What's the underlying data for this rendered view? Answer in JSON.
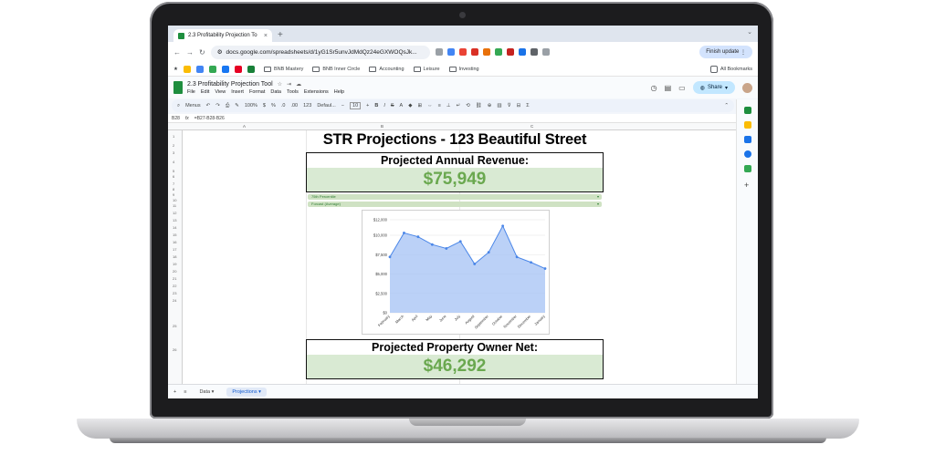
{
  "browser": {
    "tab_title": "2.3 Profitability Projection To",
    "url": "docs.google.com/spreadsheets/d/1yG1Sr5unvJdMdQz24eGXWOQsJk...",
    "update_label": "Finish update",
    "bookmarks": [
      "BNB Mastery",
      "BNB Inner Circle",
      "Accounting",
      "Leisure",
      "Investing"
    ],
    "all_bookmarks": "All Bookmarks"
  },
  "sheets": {
    "doc_title": "2.3 Profitability Projection Tool",
    "menus": [
      "File",
      "Edit",
      "View",
      "Insert",
      "Format",
      "Data",
      "Tools",
      "Extensions",
      "Help"
    ],
    "share_label": "Share",
    "toolbar": {
      "menus": "Menus",
      "zoom": "100%",
      "font": "Defaul...",
      "font_size": "10",
      "decimals": "123"
    },
    "cell_ref": "B28",
    "formula": "=B27-B28-B26",
    "columns": [
      "A",
      "B",
      "C"
    ],
    "sheet_tabs": [
      "Data",
      "Projections"
    ],
    "rows": [
      "1",
      "2",
      "3",
      "4",
      "5",
      "6",
      "7",
      "8",
      "9",
      "10",
      "11",
      "12",
      "13",
      "14",
      "15",
      "16",
      "17",
      "18",
      "19",
      "20",
      "21",
      "22",
      "23",
      "24",
      "25",
      "26"
    ]
  },
  "content": {
    "title": "STR Projections - 123 Beautiful Street",
    "revenue_label": "Projected Annual Revenue:",
    "revenue_value": "$75,949",
    "dropdown1": "75th Percentile",
    "dropdown2": "Forcast (Average)",
    "net_label": "Projected Property Owner Net:",
    "net_value": "$46,292"
  },
  "chart_data": {
    "type": "area",
    "title": "",
    "xlabel": "",
    "ylabel": "",
    "ylim": [
      0,
      12000
    ],
    "yticks": [
      "$0",
      "$2,500",
      "$5,000",
      "$7,500",
      "$10,000",
      "$12,000"
    ],
    "categories": [
      "February",
      "March",
      "April",
      "May",
      "June",
      "July",
      "August",
      "September",
      "October",
      "November",
      "December",
      "January"
    ],
    "series": [
      {
        "values": [
          7200,
          10300,
          9800,
          8800,
          8300,
          9200,
          6300,
          7800,
          11200,
          7200,
          6500,
          5700
        ]
      }
    ],
    "color": "#4a86e8",
    "fill": "#a4c2f4"
  }
}
